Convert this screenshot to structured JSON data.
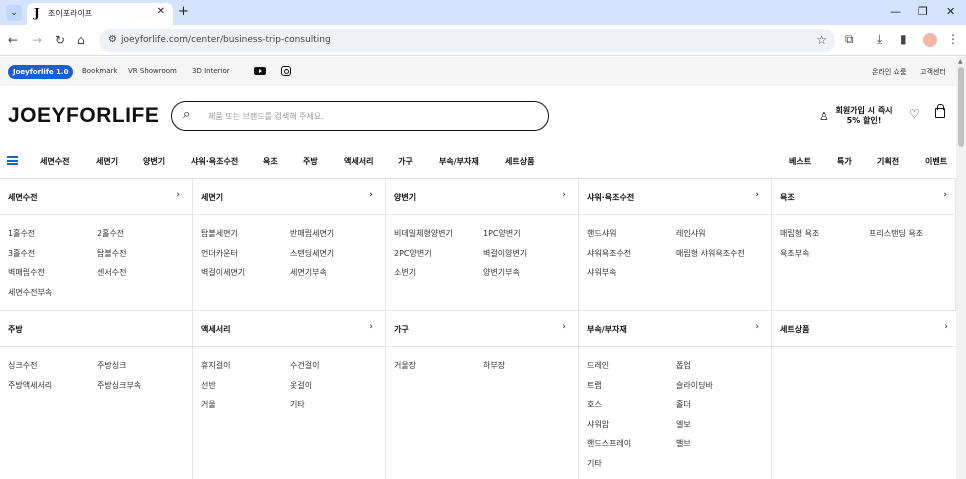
{
  "browser": {
    "tab_title": "조이포라이프",
    "tab_favicon": "J",
    "url": "joeyforlife.com/center/business-trip-consulting",
    "icons": [
      "back-icon",
      "forward-icon",
      "reload-icon",
      "home-icon",
      "site-info-icon",
      "star-icon",
      "extensions-icon",
      "download-icon",
      "sidepanel-icon",
      "menu-icon"
    ]
  },
  "util": {
    "brand_pill": "Joeyforlife 1.0",
    "links": [
      "Bookmark",
      "VR Showroom",
      "3D Interior"
    ],
    "right_links": [
      "온라인 쇼룸",
      "고객센터"
    ]
  },
  "header": {
    "logo": "JOEYFORLIFE",
    "search_placeholder": "제품 또는 브랜드를 검색해 주세요.",
    "signup_promo_line1": "회원가입 시 즉시",
    "signup_promo_line2": "5% 할인!"
  },
  "nav": {
    "left": [
      "세면수전",
      "세면기",
      "양변기",
      "샤워·욕조수전",
      "욕조",
      "주방",
      "액세서리",
      "가구",
      "부속/부자재",
      "세트상품"
    ],
    "right": [
      "베스트",
      "특가",
      "기획전",
      "이벤트"
    ]
  },
  "mega": {
    "panels": [
      {
        "title": "세면수전",
        "items": [
          "1홀수전",
          "2홀수전",
          "3홀수전",
          "탑볼수전",
          "벽매립수전",
          "센서수전",
          "세면수전부속"
        ]
      },
      {
        "title": "세면기",
        "items": [
          "탑볼세면기",
          "반매립세면기",
          "언더카운터",
          "스탠딩세면기",
          "벽걸이세면기",
          "세면기부속"
        ]
      },
      {
        "title": "양변기",
        "items": [
          "비데일체형양변기",
          "1PC양변기",
          "2PC양변기",
          "벽걸이양변기",
          "소변기",
          "양변기부속"
        ]
      },
      {
        "title": "샤워·욕조수전",
        "items": [
          "핸드샤워",
          "레인샤워",
          "샤워욕조수전",
          "매립형 샤워욕조수전",
          "샤워부속"
        ]
      },
      {
        "title": "욕조",
        "items": [
          "매립형 욕조",
          "프리스탠딩 욕조",
          "욕조부속"
        ]
      },
      {
        "title": "주방",
        "items": [
          "싱크수전",
          "주방싱크",
          "주방액세서리",
          "주방싱크부속"
        ]
      },
      {
        "title": "액세서리",
        "items": [
          "휴지걸이",
          "수건걸이",
          "선반",
          "옷걸이",
          "거울",
          "기타"
        ]
      },
      {
        "title": "가구",
        "items": [
          "거울장",
          "하부장"
        ]
      },
      {
        "title": "부속/부자재",
        "items": [
          "드레인",
          "폽업",
          "트랩",
          "슬라이딩바",
          "호스",
          "홀더",
          "샤워암",
          "엘보",
          "핸드스프레이",
          "밸브",
          "기타"
        ]
      },
      {
        "title": "세트상품",
        "items": []
      }
    ]
  }
}
